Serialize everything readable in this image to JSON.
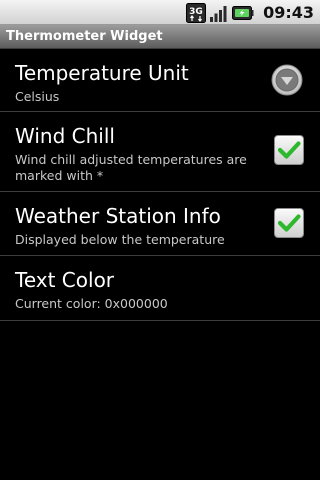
{
  "status_bar": {
    "network_label": "3G",
    "time": "09:43"
  },
  "app": {
    "title": "Thermometer Widget"
  },
  "preferences": [
    {
      "title": "Temperature Unit",
      "summary": "Celsius",
      "widget": "dropdown",
      "widget_icon": "chevron-down-icon"
    },
    {
      "title": "Wind Chill",
      "summary": "Wind chill adjusted temperatures are marked with *",
      "widget": "checkbox",
      "checked": true
    },
    {
      "title": "Weather Station Info",
      "summary": "Displayed below the temperature",
      "widget": "checkbox",
      "checked": true
    },
    {
      "title": "Text Color",
      "summary": "Current color: 0x000000",
      "widget": "none"
    }
  ],
  "colors": {
    "background": "#000000",
    "check_green": "#2eb82e",
    "divider": "#3c3c3c",
    "summary_text": "#c8c8c8"
  }
}
